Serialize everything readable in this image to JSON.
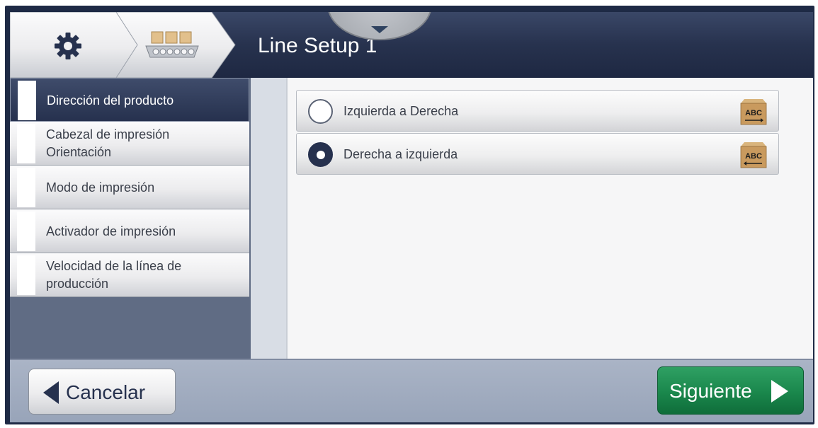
{
  "header": {
    "title": "Line Setup 1",
    "home_icon": "gear-icon",
    "line_icon": "conveyor-belt-icon",
    "pulldown_icon": "chevron-down-icon"
  },
  "sidebar": {
    "items": [
      {
        "label": "Dirección del producto",
        "active": true
      },
      {
        "label": "Cabezal de impresión\nOrientación",
        "active": false
      },
      {
        "label": "Modo de impresión",
        "active": false
      },
      {
        "label": "Activador de impresión",
        "active": false
      },
      {
        "label": "Velocidad de la línea de\nproducción",
        "active": false
      }
    ]
  },
  "options": [
    {
      "label": "Izquierda a Derecha",
      "checked": false,
      "icon": "box-abc-left-to-right-icon",
      "icon_text": "ABC"
    },
    {
      "label": "Derecha a izquierda",
      "checked": true,
      "icon": "box-abc-right-to-left-icon",
      "icon_text": "ABC"
    }
  ],
  "footer": {
    "cancel_label": "Cancelar",
    "next_label": "Siguiente"
  },
  "colors": {
    "header_dark": "#26314e",
    "next_green": "#1a874c",
    "sidebar_bg": "#606c84",
    "footer_bg": "#a3aec2"
  }
}
